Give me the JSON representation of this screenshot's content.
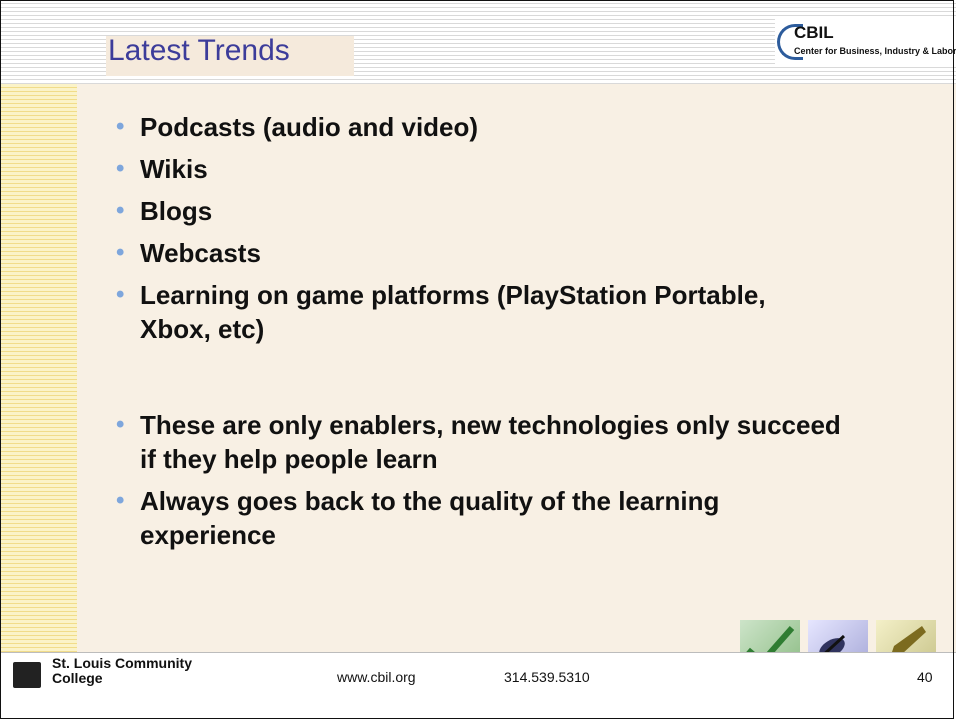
{
  "slide": {
    "title": "Latest Trends",
    "logo": {
      "name": "CBIL",
      "subtitle": "Center for Business, Industry & Labor"
    },
    "bullets": [
      "Podcasts (audio and video)",
      "Wikis",
      "Blogs",
      "Webcasts",
      "Learning on game platforms (PlayStation Portable, Xbox, etc)",
      "These are only enablers, new technologies only succeed if they help people learn",
      "Always goes back to the quality of the learning experience"
    ],
    "footer": {
      "college_line1": "St. Louis Community",
      "college_line2": "College",
      "website": "www.cbil.org",
      "phone": "314.539.5310",
      "page_number": "40"
    },
    "icons": [
      "checkmark-icon",
      "satellite-dish-icon",
      "pen-nib-icon"
    ],
    "colors": {
      "title": "#3c3c9a",
      "bullet": "#7ea6dc",
      "panel": "#f8f0e4",
      "stripe": "#f1dc8a"
    }
  }
}
